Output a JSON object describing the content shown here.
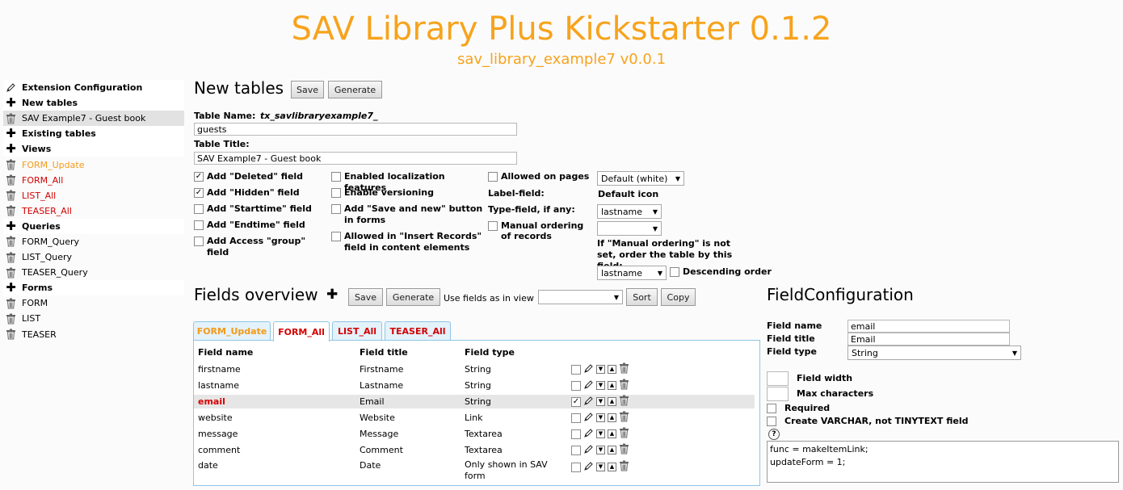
{
  "header": {
    "title": "SAV Library Plus Kickstarter 0.1.2",
    "subtitle": "sav_library_example7 v0.0.1"
  },
  "sidebar": [
    {
      "label": "Extension Configuration",
      "type": "section",
      "icon": "pencil-icon"
    },
    {
      "label": "New tables",
      "type": "section",
      "icon": "plus-icon"
    },
    {
      "label": "SAV Example7 - Guest book",
      "type": "item",
      "icon": "trash-icon",
      "selected": true
    },
    {
      "label": "Existing tables",
      "type": "section",
      "icon": "plus-icon"
    },
    {
      "label": "Views",
      "type": "section",
      "icon": "plus-icon"
    },
    {
      "label": "FORM_Update",
      "type": "item",
      "icon": "trash-icon",
      "color": "orange"
    },
    {
      "label": "FORM_All",
      "type": "item",
      "icon": "trash-icon",
      "color": "red"
    },
    {
      "label": "LIST_All",
      "type": "item",
      "icon": "trash-icon",
      "color": "red"
    },
    {
      "label": "TEASER_All",
      "type": "item",
      "icon": "trash-icon",
      "color": "red"
    },
    {
      "label": "Queries",
      "type": "section",
      "icon": "plus-icon"
    },
    {
      "label": "FORM_Query",
      "type": "item",
      "icon": "trash-icon"
    },
    {
      "label": "LIST_Query",
      "type": "item",
      "icon": "trash-icon"
    },
    {
      "label": "TEASER_Query",
      "type": "item",
      "icon": "trash-icon"
    },
    {
      "label": "Forms",
      "type": "section",
      "icon": "plus-icon"
    },
    {
      "label": "FORM",
      "type": "item",
      "icon": "trash-icon"
    },
    {
      "label": "LIST",
      "type": "item",
      "icon": "trash-icon"
    },
    {
      "label": "TEASER",
      "type": "item",
      "icon": "trash-icon"
    }
  ],
  "new_tables": {
    "heading": "New tables",
    "save": "Save",
    "generate": "Generate",
    "table_name_label": "Table Name:",
    "table_name_prefix": "tx_savlibraryexample7_",
    "table_name_value": "guests",
    "table_title_label": "Table Title:",
    "table_title_value": "SAV Example7 - Guest book",
    "col1": [
      {
        "label": "Add \"Deleted\" field",
        "checked": true
      },
      {
        "label": "Add \"Hidden\" field",
        "checked": true
      },
      {
        "label": "Add \"Starttime\" field",
        "checked": false
      },
      {
        "label": "Add \"Endtime\" field",
        "checked": false
      },
      {
        "label": "Add Access \"group\" field",
        "checked": false
      }
    ],
    "col2": [
      {
        "label": "Enabled localization features",
        "checked": false
      },
      {
        "label": "Enable versioning",
        "checked": false
      },
      {
        "label": "Add \"Save and new\" button in forms",
        "checked": false
      },
      {
        "label": "Allowed in \"Insert Records\" field in content elements",
        "checked": false
      }
    ],
    "allowed_on_pages": "Allowed on pages",
    "label_field": "Label-field:",
    "type_field": "Type-field, if any:",
    "manual_ordering": "Manual ordering of records",
    "default_icon_select": "Default (white)",
    "default_icon_label": "Default icon",
    "label_field_value": "lastname",
    "type_field_value": "",
    "order_note": "If \"Manual ordering\" is not set, order the table by this field:",
    "order_value": "lastname",
    "descending": "Descending order"
  },
  "fields_overview": {
    "heading": "Fields overview",
    "save": "Save",
    "generate": "Generate",
    "use_fields_label": "Use fields as in view",
    "use_fields_value": "",
    "sort": "Sort",
    "copy": "Copy",
    "tabs": [
      {
        "label": "FORM_Update",
        "color": "#f39a18",
        "active": false
      },
      {
        "label": "FORM_All",
        "color": "#d40000",
        "active": true
      },
      {
        "label": "LIST_All",
        "color": "#d40000",
        "active": false
      },
      {
        "label": "TEASER_All",
        "color": "#d40000",
        "active": false
      }
    ],
    "columns": [
      "Field name",
      "Field title",
      "Field type"
    ],
    "rows": [
      {
        "name": "firstname",
        "title": "Firstname",
        "type": "String",
        "checked": false,
        "highlight": false
      },
      {
        "name": "lastname",
        "title": "Lastname",
        "type": "String",
        "checked": false,
        "highlight": false
      },
      {
        "name": "email",
        "title": "Email",
        "type": "String",
        "checked": true,
        "highlight": true
      },
      {
        "name": "website",
        "title": "Website",
        "type": "Link",
        "checked": false,
        "highlight": false
      },
      {
        "name": "message",
        "title": "Message",
        "type": "Textarea",
        "checked": false,
        "highlight": false
      },
      {
        "name": "comment",
        "title": "Comment",
        "type": "Textarea",
        "checked": false,
        "highlight": false
      },
      {
        "name": "date",
        "title": "Date",
        "type": "Only shown in SAV form",
        "checked": false,
        "highlight": false
      }
    ]
  },
  "field_config": {
    "heading": "FieldConfiguration",
    "name_label": "Field name",
    "name_value": "email",
    "title_label": "Field title",
    "title_value": "Email",
    "type_label": "Field type",
    "type_value": "String",
    "width_label": "Field width",
    "max_label": "Max characters",
    "required_label": "Required",
    "varchar_label": "Create VARCHAR, not TINYTEXT field",
    "help_icon": "?",
    "config_line1": "func = makeItemLink;",
    "config_line2": "updateForm = 1;"
  }
}
